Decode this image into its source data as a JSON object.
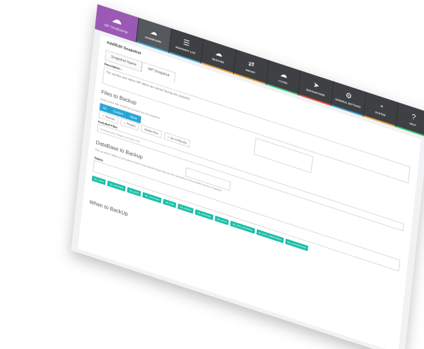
{
  "brand": {
    "name": "WP TimeBackup",
    "icon": "cloud-upload-icon"
  },
  "nav": [
    {
      "label": "DASHBOARD",
      "icon": "cloud-icon",
      "strip": "#3aa4d6",
      "active": true
    },
    {
      "label": "SNAPSHOT LIST",
      "icon": "list-icon",
      "strip": "#3aa4d6"
    },
    {
      "label": "RESTORE",
      "icon": "cloud-download-icon",
      "strip": "#e7a03b"
    },
    {
      "label": "IMPORT",
      "icon": "import-icon",
      "strip": "#e7a03b"
    },
    {
      "label": "CLOUD",
      "icon": "cloud-icon",
      "strip": "#2ecc71"
    },
    {
      "label": "DESTINATIONS",
      "icon": "paper-plane-icon",
      "strip": "#e74c3c"
    },
    {
      "label": "GENERAL SETTINGS",
      "icon": "gear-icon",
      "strip": "#3aa4d6"
    },
    {
      "label": "SYSTEM",
      "icon": "speedometer-icon",
      "strip": "#e7a03b"
    },
    {
      "label": "HELP",
      "icon": "help-icon",
      "strip": "#2ecc71"
    }
  ],
  "page": {
    "title": "Add/Edit Snapshot",
    "tab_snapshot_name": "Snapshot Name",
    "tab_wp_snapshot": "WP Snapshot",
    "description_label": "Description :",
    "description_value": "The wp files and native WP tables are stored during this snapshot"
  },
  "files": {
    "title": "Files to Backup",
    "help": "Select which files should be included into the Snapshot",
    "segments": [
      "All",
      "Custom",
      "None"
    ],
    "checks": [
      "Themes",
      "Plugins",
      "Media Files",
      "wp-config.php"
    ],
    "included_label": "Included Files",
    "included_placeholder": "example.php,image.png,style.css"
  },
  "database": {
    "title": "DataBase to Backup",
    "help": "Pick up all the Tables or just some of them and exclude those that are not necessary to be included into this Snapshot",
    "tables_label": "Tables",
    "tags": [
      "wp_users",
      "wp_usermeta",
      "wp_posts",
      "wp_comments",
      "wp_links",
      "wp_options",
      "wp_postmeta",
      "wp_terms",
      "wp_term_taxonomy",
      "wp_term_relationships",
      "wp_commentmeta"
    ]
  },
  "when": {
    "title": "When to BackUp"
  }
}
